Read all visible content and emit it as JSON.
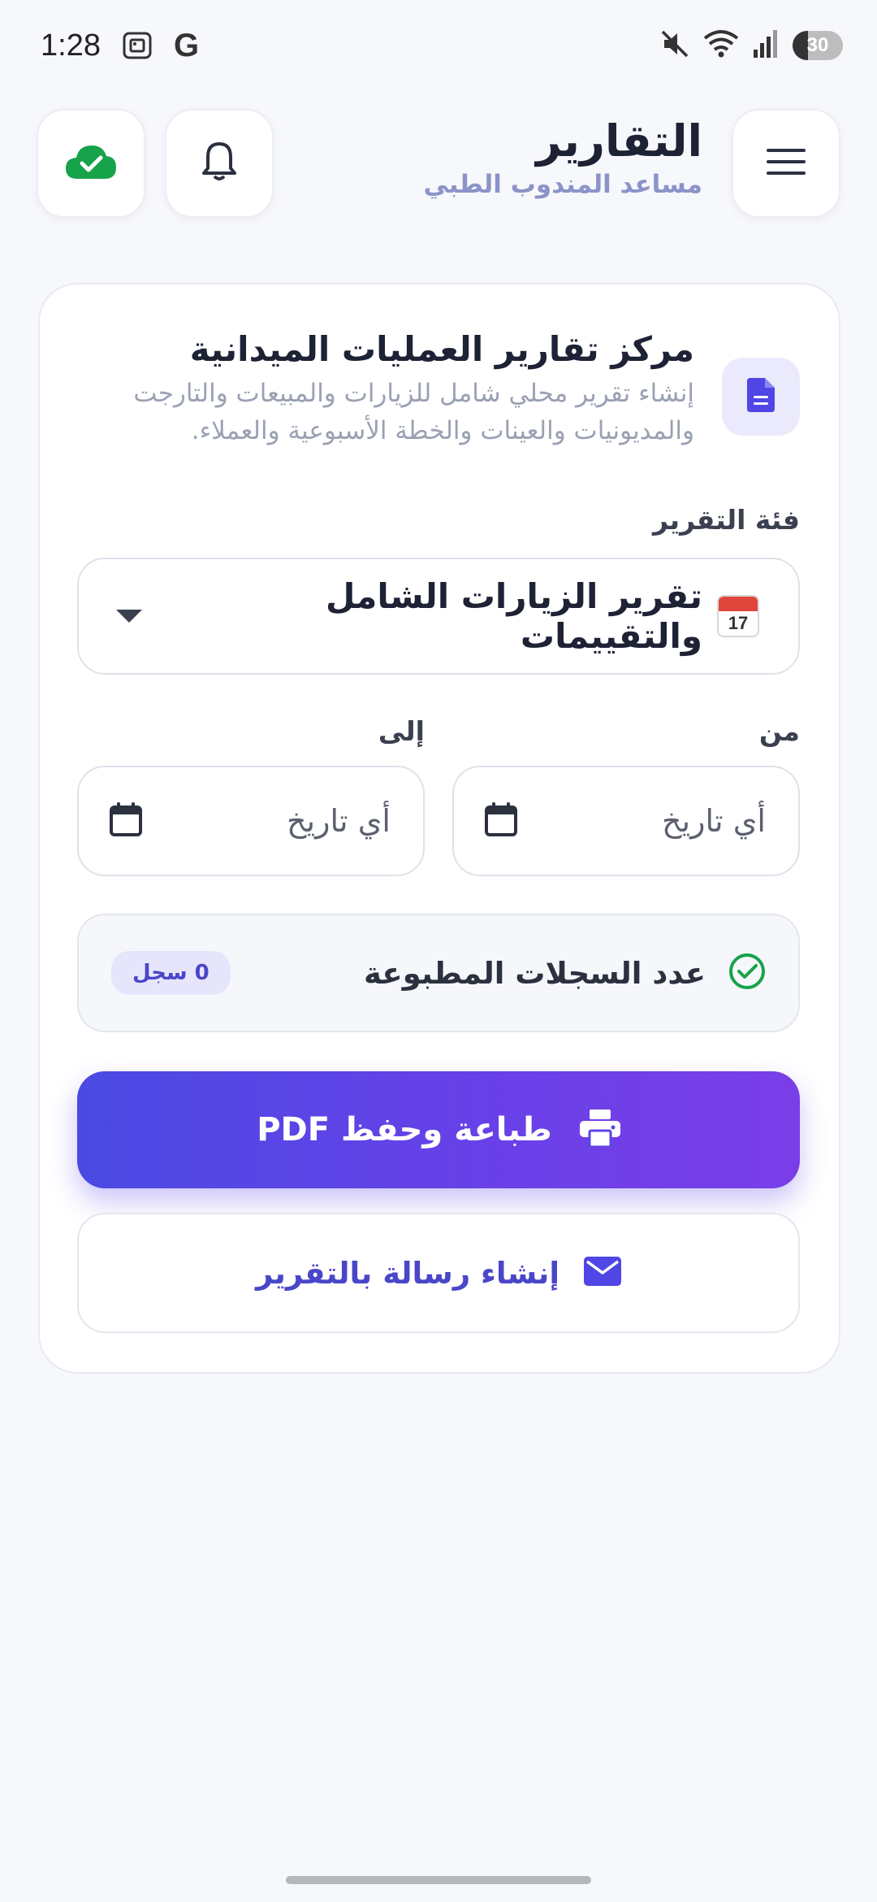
{
  "status_bar": {
    "time": "1:28",
    "google_glyph": "G",
    "battery_level": "30",
    "icons": [
      "screenshot-icon",
      "google-icon",
      "mute-icon",
      "wifi-icon",
      "signal-icon",
      "battery-icon"
    ]
  },
  "header": {
    "title": "التقارير",
    "subtitle": "مساعد المندوب الطبي",
    "buttons": [
      "menu-icon",
      "bell-icon",
      "cloud-check-icon"
    ]
  },
  "report_center": {
    "title": "مركز تقارير العمليات الميدانية",
    "description": "إنشاء تقرير محلي شامل للزيارات والمبيعات والتارجت والمديونيات والعينات والخطة الأسبوعية والعملاء.",
    "icon": "document-icon"
  },
  "category": {
    "label": "فئة التقرير",
    "selected": "تقرير الزيارات الشامل والتقييمات",
    "emoji_day": "17"
  },
  "date_range": {
    "from_label": "من",
    "to_label": "إلى",
    "from_placeholder": "أي تاريخ",
    "to_placeholder": "أي تاريخ"
  },
  "records": {
    "label": "عدد السجلات المطبوعة",
    "count": "0 سجل"
  },
  "actions": {
    "print_label": "طباعة وحفظ PDF",
    "email_label": "إنشاء رسالة بالتقرير"
  },
  "colors": {
    "accent": "#5b46e6",
    "success": "#16a34a",
    "background": "#f7f8fc"
  }
}
